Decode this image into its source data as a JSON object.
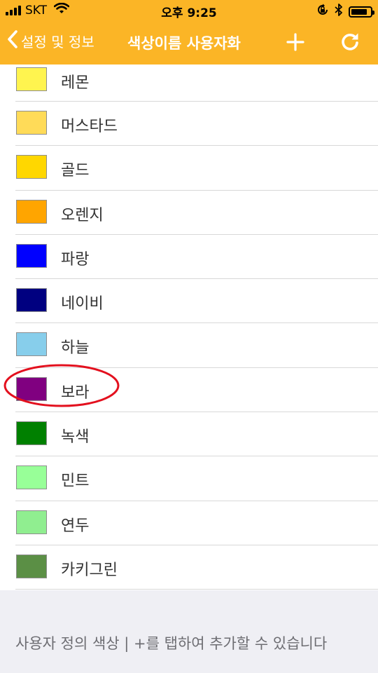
{
  "status_bar": {
    "carrier": "SKT",
    "time": "오후 9:25",
    "battery_level": 0.85
  },
  "nav": {
    "back_label": "설정 및 정보",
    "title": "색상이름 사용자화",
    "add_icon": "plus-icon",
    "refresh_icon": "refresh-icon"
  },
  "colors": [
    {
      "name": "레몬",
      "swatch": "#fff44f"
    },
    {
      "name": "머스타드",
      "swatch": "#ffdb58"
    },
    {
      "name": "골드",
      "swatch": "#ffd700"
    },
    {
      "name": "오렌지",
      "swatch": "#ffa500"
    },
    {
      "name": "파랑",
      "swatch": "#0000ff"
    },
    {
      "name": "네이비",
      "swatch": "#000080"
    },
    {
      "name": "하늘",
      "swatch": "#87ceeb"
    },
    {
      "name": "보라",
      "swatch": "#800080"
    },
    {
      "name": "녹색",
      "swatch": "#008000"
    },
    {
      "name": "민트",
      "swatch": "#98ff98"
    },
    {
      "name": "연두",
      "swatch": "#90ee90"
    },
    {
      "name": "카키그린",
      "swatch": "#5b8f45"
    }
  ],
  "highlighted_color": "보라",
  "highlight_color": "#e3101e",
  "accent_color": "#fbb526",
  "footer": {
    "text": "사용자 정의 색상 | +를 탭하여 추가할 수 있습니다"
  }
}
